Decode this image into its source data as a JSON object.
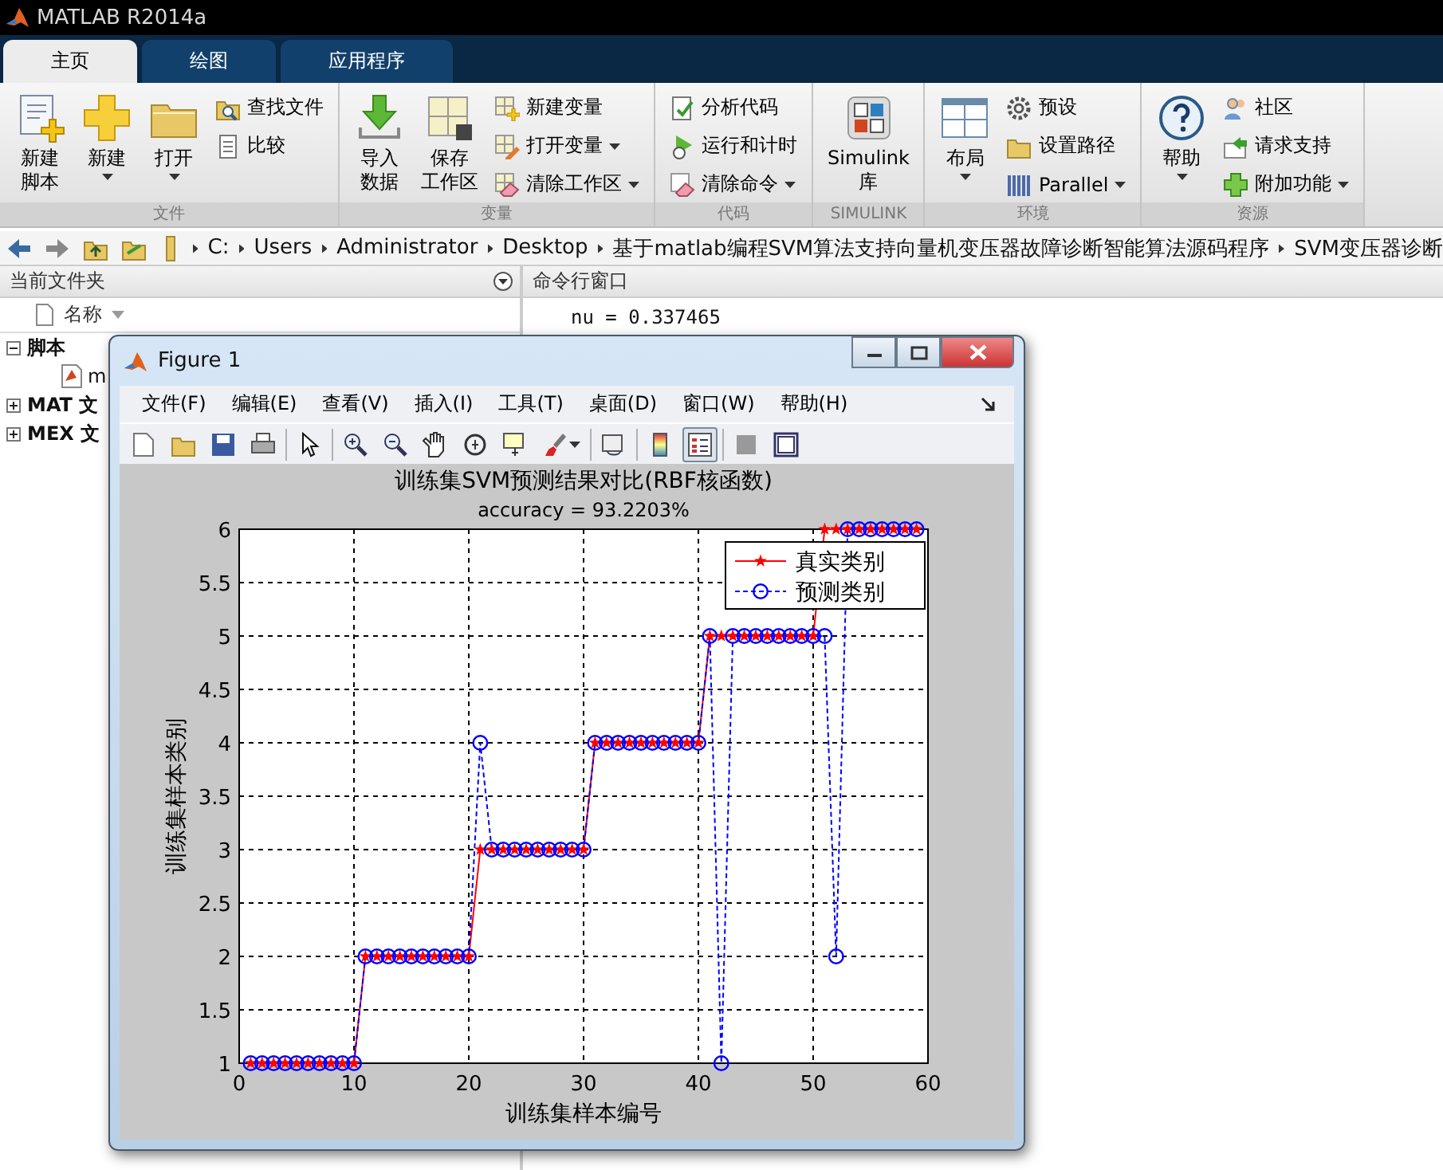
{
  "window": {
    "title": "MATLAB R2014a"
  },
  "tabs": [
    {
      "label": "主页",
      "selected": true
    },
    {
      "label": "绘图",
      "selected": false
    },
    {
      "label": "应用程序",
      "selected": false
    }
  ],
  "ribbon": {
    "groups": [
      {
        "label": "文件",
        "items": [
          {
            "kind": "large",
            "label": [
              "新建",
              "脚本"
            ],
            "dropdown": false
          },
          {
            "kind": "large",
            "label": [
              "新建"
            ],
            "dropdown": true
          },
          {
            "kind": "large",
            "label": [
              "打开"
            ],
            "dropdown": true
          },
          {
            "kind": "column",
            "items": [
              {
                "label": "查找文件",
                "dropdown": false
              },
              {
                "label": "比较",
                "dropdown": false
              }
            ]
          }
        ]
      },
      {
        "label": "变量",
        "items": [
          {
            "kind": "large",
            "label": [
              "导入",
              "数据"
            ],
            "dropdown": false
          },
          {
            "kind": "large",
            "label": [
              "保存",
              "工作区"
            ],
            "dropdown": false
          },
          {
            "kind": "column",
            "items": [
              {
                "label": "新建变量",
                "dropdown": false
              },
              {
                "label": "打开变量",
                "dropdown": true
              },
              {
                "label": "清除工作区",
                "dropdown": true
              }
            ]
          }
        ]
      },
      {
        "label": "代码",
        "items": [
          {
            "kind": "column",
            "items": [
              {
                "label": "分析代码",
                "dropdown": false
              },
              {
                "label": "运行和计时",
                "dropdown": false
              },
              {
                "label": "清除命令",
                "dropdown": true
              }
            ]
          }
        ]
      },
      {
        "label": "SIMULINK",
        "items": [
          {
            "kind": "large",
            "label": [
              "Simulink",
              "库"
            ],
            "dropdown": false
          }
        ]
      },
      {
        "label": "环境",
        "items": [
          {
            "kind": "large",
            "label": [
              "布局"
            ],
            "dropdown": true
          },
          {
            "kind": "column",
            "items": [
              {
                "label": "预设",
                "dropdown": false
              },
              {
                "label": "设置路径",
                "dropdown": false
              },
              {
                "label": "Parallel",
                "dropdown": true
              }
            ]
          }
        ]
      },
      {
        "label": "资源",
        "items": [
          {
            "kind": "large",
            "label": [
              "帮助"
            ],
            "dropdown": true
          },
          {
            "kind": "column",
            "items": [
              {
                "label": "社区",
                "dropdown": false
              },
              {
                "label": "请求支持",
                "dropdown": false
              },
              {
                "label": "附加功能",
                "dropdown": true
              }
            ]
          }
        ]
      }
    ]
  },
  "path_bar": {
    "segments": [
      "C:",
      "Users",
      "Administrator",
      "Desktop",
      "基于matlab编程SVM算法支持向量机变压器故障诊断智能算法源码程序",
      "SVM变压器诊断"
    ]
  },
  "current_folder": {
    "title": "当前文件夹",
    "column": "名称",
    "tree": [
      {
        "label": "脚本",
        "expanded": true,
        "children": [
          {
            "label": "m"
          }
        ]
      },
      {
        "label": "MAT 文",
        "expanded": false
      },
      {
        "label": "MEX 文",
        "expanded": false
      }
    ]
  },
  "command_window": {
    "title": "命令行窗口",
    "lines": [
      "nu = 0.337465"
    ]
  },
  "figure": {
    "title": "Figure 1",
    "menu": [
      "文件(F)",
      "编辑(E)",
      "查看(V)",
      "插入(I)",
      "工具(T)",
      "桌面(D)",
      "窗口(W)",
      "帮助(H)"
    ],
    "toolbar": [
      {
        "kind": "button",
        "pressed": false
      },
      {
        "kind": "button",
        "pressed": false
      },
      {
        "kind": "button",
        "pressed": false
      },
      {
        "kind": "button",
        "pressed": false
      },
      {
        "kind": "separator"
      },
      {
        "kind": "button",
        "pressed": false
      },
      {
        "kind": "separator"
      },
      {
        "kind": "button",
        "pressed": false
      },
      {
        "kind": "button",
        "pressed": false
      },
      {
        "kind": "button",
        "pressed": false
      },
      {
        "kind": "button",
        "pressed": false
      },
      {
        "kind": "button",
        "pressed": false
      },
      {
        "kind": "button",
        "pressed": false,
        "dropdown": true
      },
      {
        "kind": "separator"
      },
      {
        "kind": "button",
        "pressed": false
      },
      {
        "kind": "separator"
      },
      {
        "kind": "button",
        "pressed": false
      },
      {
        "kind": "button",
        "pressed": true
      },
      {
        "kind": "separator"
      },
      {
        "kind": "button",
        "pressed": false
      },
      {
        "kind": "button",
        "pressed": false
      }
    ],
    "chart_data": {
      "type": "line",
      "title": "训练集SVM预测结果对比(RBF核函数)",
      "subtitle": "accuracy = 93.2203%",
      "xlabel": "训练集样本编号",
      "ylabel": "训练集样本类别",
      "x": [
        1,
        2,
        3,
        4,
        5,
        6,
        7,
        8,
        9,
        10,
        11,
        12,
        13,
        14,
        15,
        16,
        17,
        18,
        19,
        20,
        21,
        22,
        23,
        24,
        25,
        26,
        27,
        28,
        29,
        30,
        31,
        32,
        33,
        34,
        35,
        36,
        37,
        38,
        39,
        40,
        41,
        42,
        43,
        44,
        45,
        46,
        47,
        48,
        49,
        50,
        51,
        52,
        53,
        54,
        55,
        56,
        57,
        58,
        59
      ],
      "series": [
        {
          "name": "真实类别",
          "color": "#ff0000",
          "line_style": "solid",
          "marker": "star",
          "values": [
            1,
            1,
            1,
            1,
            1,
            1,
            1,
            1,
            1,
            1,
            2,
            2,
            2,
            2,
            2,
            2,
            2,
            2,
            2,
            2,
            3,
            3,
            3,
            3,
            3,
            3,
            3,
            3,
            3,
            3,
            4,
            4,
            4,
            4,
            4,
            4,
            4,
            4,
            4,
            4,
            5,
            5,
            5,
            5,
            5,
            5,
            5,
            5,
            5,
            5,
            6,
            6,
            6,
            6,
            6,
            6,
            6,
            6,
            6
          ]
        },
        {
          "name": "预测类别",
          "color": "#0000ff",
          "line_style": "dashed",
          "marker": "circle",
          "values": [
            1,
            1,
            1,
            1,
            1,
            1,
            1,
            1,
            1,
            1,
            2,
            2,
            2,
            2,
            2,
            2,
            2,
            2,
            2,
            2,
            4,
            3,
            3,
            3,
            3,
            3,
            3,
            3,
            3,
            3,
            4,
            4,
            4,
            4,
            4,
            4,
            4,
            4,
            4,
            4,
            5,
            1,
            5,
            5,
            5,
            5,
            5,
            5,
            5,
            5,
            5,
            2,
            6,
            6,
            6,
            6,
            6,
            6,
            6
          ]
        }
      ],
      "grid": true,
      "legend": true,
      "xlim": [
        0,
        60
      ],
      "ylim": [
        1,
        6
      ],
      "xticks": [
        0,
        10,
        20,
        30,
        40,
        50,
        60
      ],
      "yticks": [
        1,
        1.5,
        2,
        2.5,
        3,
        3.5,
        4,
        4.5,
        5,
        5.5,
        6
      ]
    }
  }
}
